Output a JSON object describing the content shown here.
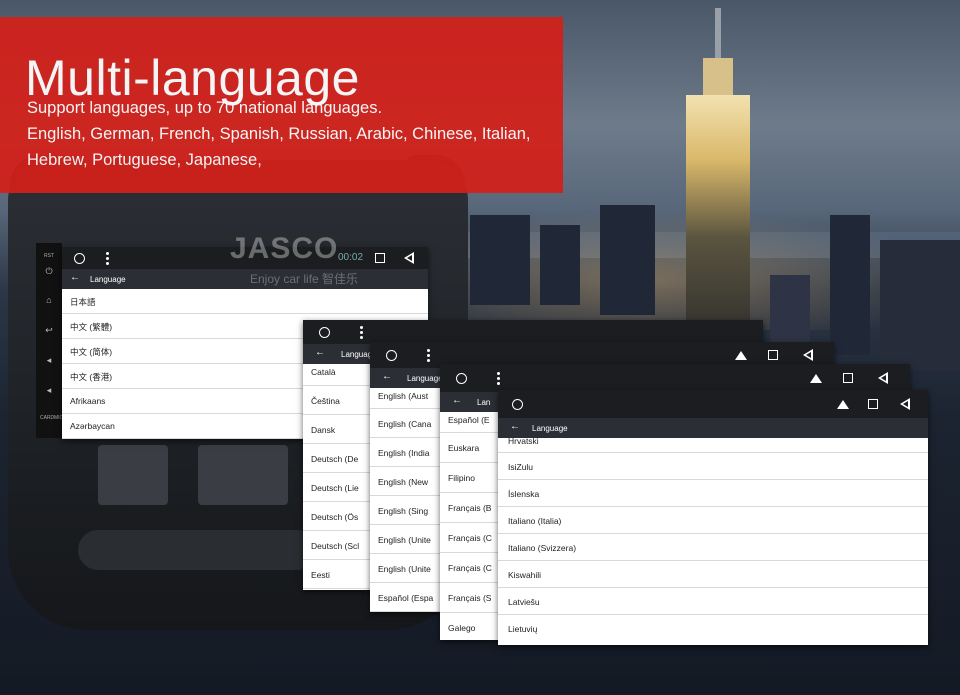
{
  "banner": {
    "title": "Multi-language",
    "lines": [
      "Support languages, up to 70 national languages.",
      "English, German, French, Spanish, Russian, Arabic, Chinese, Italian,",
      "Hebrew, Portuguese, Japanese,"
    ]
  },
  "watermark": {
    "brand": "JASCO",
    "tagline": "Enjoy car life 智佳乐"
  },
  "head_unit": {
    "side_labels": {
      "rst": "RST",
      "mic": "MIC",
      "card": "CARD"
    },
    "status_time": "00:02",
    "screen": {
      "header": "Language",
      "items": [
        "日本語",
        "中文 (繁體)",
        "中文 (简体)",
        "中文 (香港)",
        "Afrikaans",
        "Azərbaycan"
      ]
    }
  },
  "screens": [
    {
      "header": "Language",
      "items": [
        "Català",
        "Čeština",
        "Dansk",
        "Deutsch (De",
        "Deutsch (Lie",
        "Deutsch (Ös",
        "Deutsch (Scl",
        "Eesti"
      ]
    },
    {
      "header": "Language",
      "items": [
        "English (Aust",
        "English (Cana",
        "English (India",
        "English (New",
        "English (Sing",
        "English (Unite",
        "English (Unite",
        "Español (Espa"
      ]
    },
    {
      "header": "Lan",
      "items": [
        "Español (E",
        "Euskara",
        "Filipino",
        "Français (B",
        "Français (C",
        "Français (C",
        "Français (S",
        "Galego"
      ]
    },
    {
      "header": "Language",
      "items": [
        "Hrvatski",
        "IsiZulu",
        "Íslenska",
        "Italiano (Italia)",
        "Italiano (Svizzera)",
        "Kiswahili",
        "Latviešu",
        "Lietuvių"
      ]
    }
  ],
  "icons": {
    "home": "home-circle-icon",
    "menu": "overflow-menu-icon",
    "recents": "recents-square-icon",
    "back": "back-triangle-icon",
    "eject": "eject-icon",
    "up_arrow": "back-arrow-icon"
  },
  "colors": {
    "banner": "#d4201a",
    "status_bar": "#1b1d20",
    "title_bar": "#2b2f35"
  }
}
